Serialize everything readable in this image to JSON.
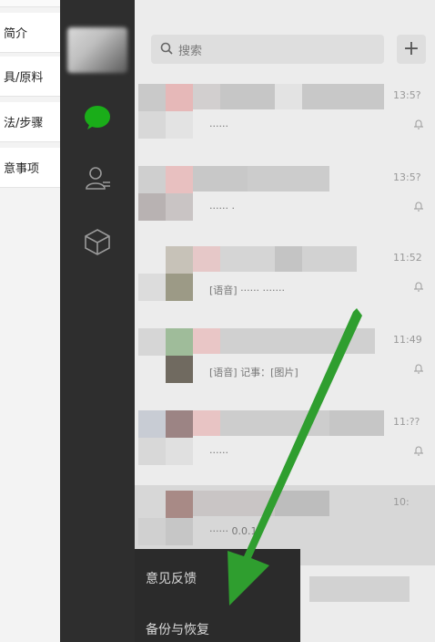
{
  "doc_sidebar": {
    "items": [
      {
        "label": "简介"
      },
      {
        "label": "具/原料"
      },
      {
        "label": "法/步骤"
      },
      {
        "label": "意事项"
      }
    ]
  },
  "sidebar": {
    "icons": [
      "chat-icon",
      "contacts-icon",
      "cube-icon"
    ],
    "chat_color": "#1aad19"
  },
  "search": {
    "placeholder": "搜索",
    "add_label": "+"
  },
  "chats": [
    {
      "message": "······",
      "time": "13:5?"
    },
    {
      "message": "······ ·",
      "time": "13:5?"
    },
    {
      "message": "[语音] ······  ·······",
      "time": "11:52"
    },
    {
      "message": "[语音] 记事：[图片]",
      "time": "11:49"
    },
    {
      "message": "······",
      "time": "11:??"
    },
    {
      "message": "······  0.0.10",
      "time": "10:"
    },
    {
      "message": "",
      "time": ""
    }
  ],
  "menu": {
    "items": [
      {
        "label": "意见反馈"
      },
      {
        "label": "备份与恢复"
      }
    ]
  },
  "annotation": {
    "arrow_color": "#2f9e2f"
  }
}
